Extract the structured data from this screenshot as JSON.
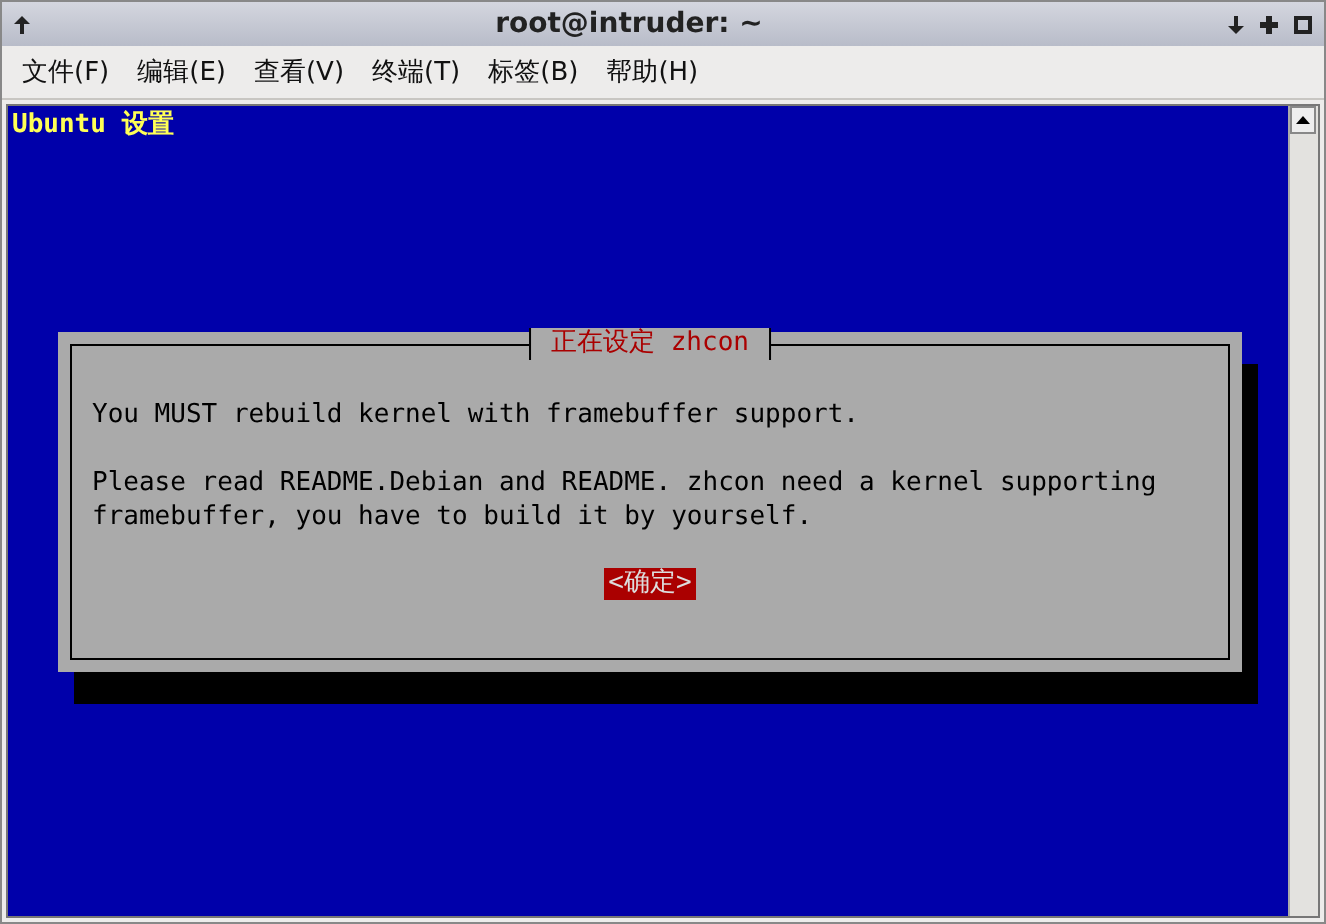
{
  "window": {
    "title": "root@intruder: ~"
  },
  "menu": [
    "文件(F)",
    "编辑(E)",
    "查看(V)",
    "终端(T)",
    "标签(B)",
    "帮助(H)"
  ],
  "terminal": {
    "backtitle": "Ubuntu 设置",
    "dialog": {
      "title": "正在设定 zhcon",
      "paragraphs": [
        [
          "You MUST rebuild kernel with framebuffer support."
        ],
        [
          "Please read README.Debian and README. zhcon need a kernel supporting",
          "framebuffer, you have to build it by yourself."
        ]
      ],
      "button": "<确定>"
    }
  }
}
